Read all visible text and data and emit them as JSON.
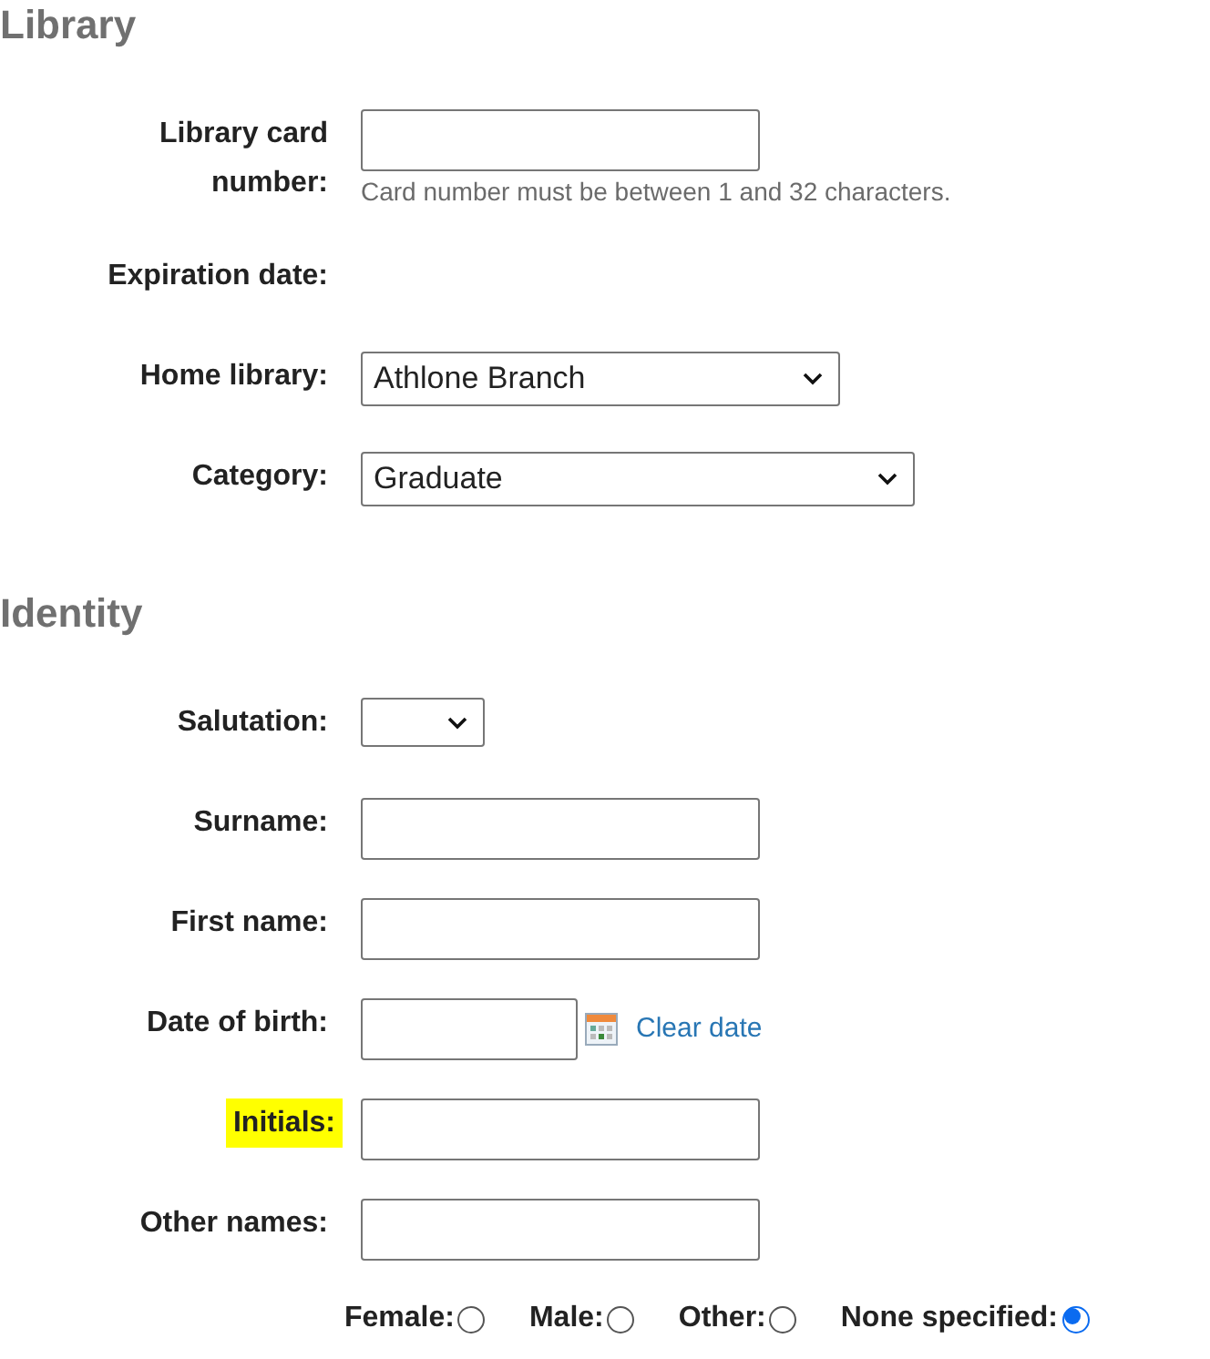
{
  "sections": [
    {
      "heading": "Library",
      "fields": [
        {
          "kind": "text",
          "label": "Library card number:",
          "hint": "Card number must be between 1 and 32 characters.",
          "highlighted": false
        },
        {
          "kind": "static",
          "label": "Expiration date:",
          "highlighted": false
        },
        {
          "kind": "select",
          "label": "Home library:",
          "value": "Athlone Branch",
          "highlighted": false
        },
        {
          "kind": "select",
          "label": "Category:",
          "value": "Graduate",
          "highlighted": false
        }
      ]
    },
    {
      "heading": "Identity",
      "fields": [
        {
          "kind": "select",
          "label": "Salutation:",
          "highlighted": false
        },
        {
          "kind": "text",
          "label": "Surname:",
          "highlighted": false
        },
        {
          "kind": "text",
          "label": "First name:",
          "highlighted": false
        },
        {
          "kind": "date",
          "label": "Date of birth:",
          "link": "Clear date",
          "highlighted": false
        },
        {
          "kind": "text",
          "label": "Initials:",
          "highlighted": true
        },
        {
          "kind": "text",
          "label": "Other names:",
          "highlighted": false
        }
      ]
    }
  ],
  "gender": [
    {
      "label": "Female:",
      "selected": false
    },
    {
      "label": "Male:",
      "selected": false
    },
    {
      "label": "Other:",
      "selected": false
    },
    {
      "label": "None specified:",
      "selected": true
    }
  ]
}
